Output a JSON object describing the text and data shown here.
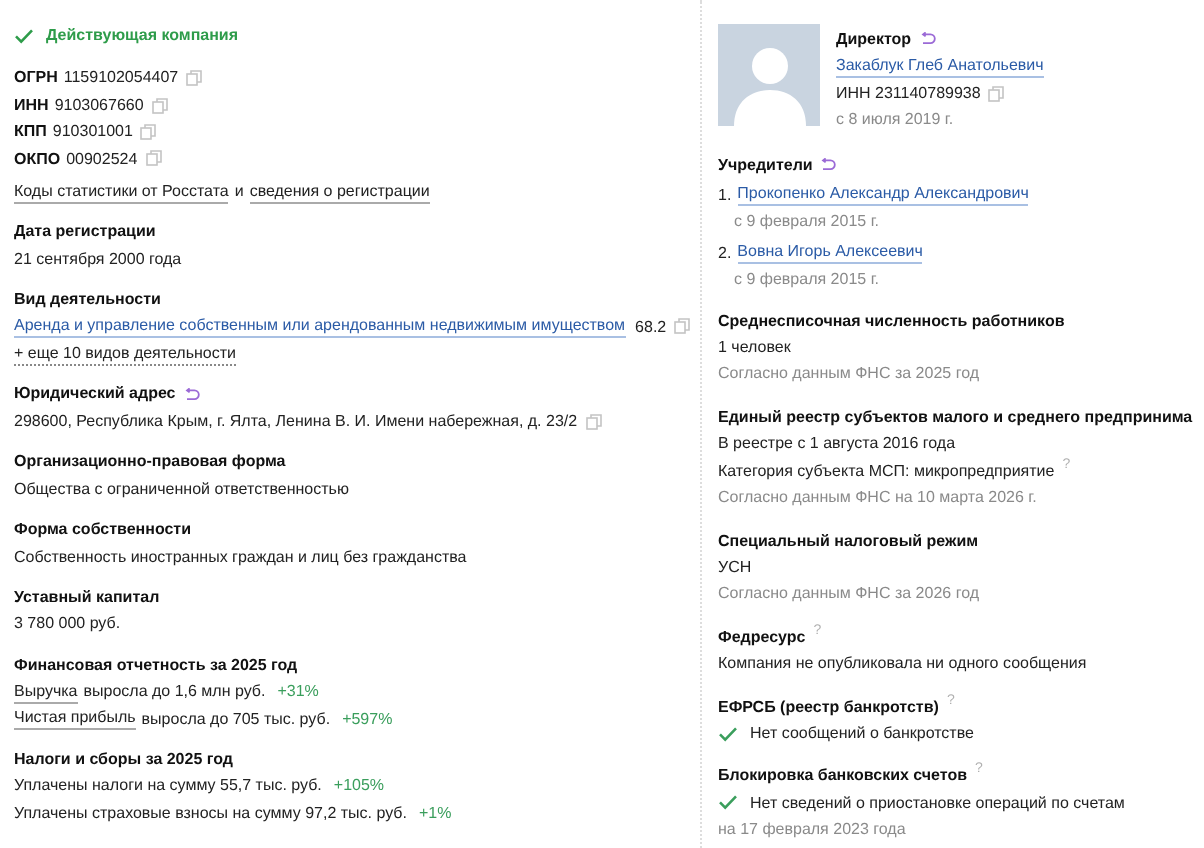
{
  "status": {
    "text": "Действующая компания",
    "active": true
  },
  "codes": [
    {
      "label": "ОГРН",
      "value": "1159102054407"
    },
    {
      "label": "ИНН",
      "value": "9103067660"
    },
    {
      "label": "КПП",
      "value": "910301001"
    },
    {
      "label": "ОКПО",
      "value": "00902524"
    }
  ],
  "stats_links": {
    "first": "Коды статистики от Росстата",
    "joiner": "и",
    "second": "сведения о регистрации"
  },
  "left_sections": [
    {
      "title": "Дата регистрации",
      "rows": [
        {
          "kind": "text",
          "text": "21 сентября 2000 года"
        }
      ]
    },
    {
      "title": "Вид деятельности",
      "rows": [
        {
          "kind": "activity",
          "text": "Аренда и управление собственным или арендованным недвижимым имуществом",
          "code": "68.2"
        },
        {
          "kind": "more",
          "text": "+ еще 10 видов деятельности"
        }
      ]
    },
    {
      "title": "Юридический адрес",
      "kind": "history",
      "rows": [
        {
          "kind": "copy",
          "text": "298600, Республика Крым, г. Ялта, Ленина В. И. Имени набережная, д. 23/2"
        }
      ]
    },
    {
      "title": "Организационно-правовая форма",
      "rows": [
        {
          "kind": "text",
          "text": "Общества с ограниченной ответственностью"
        }
      ]
    },
    {
      "title": "Форма собственности",
      "rows": [
        {
          "kind": "text",
          "text": "Собственность иностранных граждан и лиц без гражданства"
        }
      ]
    },
    {
      "title": "Уставный капитал",
      "rows": [
        {
          "kind": "text",
          "text": "3 780 000 руб."
        }
      ]
    },
    {
      "title": "Финансовая отчетность за 2025 год",
      "rows": [
        {
          "kind": "metric",
          "term": "Выручка",
          "text": "выросла до 1,6 млн руб.",
          "delta": "+31%"
        },
        {
          "kind": "metric",
          "term": "Чистая прибыль",
          "text": "выросла до 705 тыс. руб.",
          "delta": "+597%"
        }
      ]
    },
    {
      "title": "Налоги и сборы за 2025 год",
      "rows": [
        {
          "kind": "metric",
          "text": "Уплачены налоги на сумму 55,7 тыс. руб.",
          "delta": "+105%"
        },
        {
          "kind": "metric",
          "text": "Уплачены страховые взносы на сумму 97,2 тыс. руб.",
          "delta": "+1%"
        }
      ]
    }
  ],
  "director": {
    "role": "Директор",
    "name": "Закаблук Глеб Анатольевич",
    "inn": "ИНН 231140789938",
    "since": "с 8 июля 2019 г."
  },
  "founders": {
    "title": "Учредители",
    "items": [
      {
        "number": "1.",
        "name": "Прокопенко Александр Александрович",
        "since": "с 9 февраля 2015 г."
      },
      {
        "number": "2.",
        "name": "Вовна Игорь Алексеевич",
        "since": "с 9 февраля 2015 г."
      }
    ]
  },
  "right_sections": [
    {
      "title": "Среднесписочная численность работников",
      "rows": [
        {
          "kind": "text",
          "text": "1 человек"
        },
        {
          "kind": "note",
          "text": "Согласно данным ФНС за 2025 год"
        }
      ]
    },
    {
      "title": "Единый реестр субъектов малого и среднего предпринима",
      "rows": [
        {
          "kind": "text",
          "text": "В реестре с 1 августа 2016 года"
        },
        {
          "kind": "help",
          "text": "Категория субъекта МСП: микропредприятие",
          "mark": "?"
        },
        {
          "kind": "note",
          "text": "Согласно данным ФНС на 10 марта 2026 г."
        }
      ]
    },
    {
      "title": "Специальный налоговый режим",
      "rows": [
        {
          "kind": "text",
          "text": "УСН"
        },
        {
          "kind": "note",
          "text": "Согласно данным ФНС за 2026 год"
        }
      ]
    },
    {
      "title": "Федресурс",
      "kind": "help",
      "mark": "?",
      "rows": [
        {
          "kind": "text",
          "text": "Компания не опубликовала ни одного сообщения"
        }
      ]
    },
    {
      "title": "ЕФРСБ (реестр банкротств)",
      "kind": "help",
      "mark": "?",
      "rows": [
        {
          "kind": "check",
          "text": "Нет сообщений о банкротстве"
        }
      ]
    },
    {
      "title": "Блокировка банковских счетов",
      "kind": "help",
      "mark": "?",
      "rows": [
        {
          "kind": "check",
          "text": "Нет сведений о приостановке операций по счетам"
        },
        {
          "kind": "note",
          "text": "на 17 февраля 2023 года"
        }
      ]
    }
  ]
}
